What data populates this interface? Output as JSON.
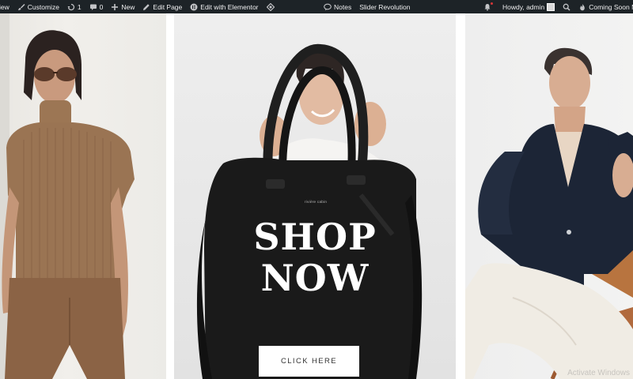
{
  "admin_bar": {
    "left_items": [
      {
        "label": "iew",
        "icon": "view-icon"
      },
      {
        "label": "Customize",
        "icon": "brush-icon"
      },
      {
        "label": "1",
        "icon": "updates-icon"
      },
      {
        "label": "0",
        "icon": "comment-icon"
      },
      {
        "label": "New",
        "icon": "plus-icon"
      },
      {
        "label": "Edit Page",
        "icon": "pencil-icon"
      },
      {
        "label": "Edit with Elementor",
        "icon": "elementor-icon"
      },
      {
        "label": "",
        "icon": "diamond-icon"
      }
    ],
    "center_items": [
      {
        "label": "Notes",
        "icon": "chat-icon"
      },
      {
        "label": "Slider Revolution",
        "icon": ""
      }
    ],
    "right_items": [
      {
        "label": "",
        "icon": "bell-icon"
      },
      {
        "label": "Howdy, admin",
        "icon": "avatar"
      },
      {
        "label": "",
        "icon": "search-icon"
      },
      {
        "label": "Coming Soon Mode",
        "icon": "fire-icon"
      }
    ]
  },
  "hero": {
    "heading_line1": "SHOP",
    "heading_line2": "NOW",
    "button_label": "CLICK HERE",
    "bag_brand": "rivière cabin"
  },
  "watermark": "Activate Windows",
  "colors": {
    "admin_bar_bg": "#1d2327",
    "admin_bar_text": "#f0f0f1",
    "button_bg": "#ffffff",
    "heading_text": "#ffffff"
  }
}
